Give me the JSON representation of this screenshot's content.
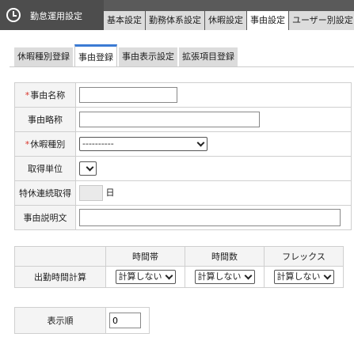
{
  "app": {
    "title": "勤怠運用設定",
    "icon": "clock-icon"
  },
  "top_tabs": [
    "基本設定",
    "勤務体系設定",
    "休暇設定",
    "事由設定",
    "ユーザー別設定"
  ],
  "sub_tabs": [
    "休暇種別登録",
    "事由登録",
    "事由表示設定",
    "拡張項目登録"
  ],
  "form": {
    "required_mark": "*",
    "reason_name_label": "事由名称",
    "reason_name_value": "",
    "reason_abbr_label": "事由略称",
    "reason_abbr_value": "",
    "leave_type_label": "休暇種別",
    "leave_type_selected": "----------",
    "unit_label": "取得単位",
    "unit_selected": "",
    "special_leave_label": "特休連続取得",
    "special_leave_value": "",
    "special_leave_unit": "日",
    "description_label": "事由説明文",
    "description_value": ""
  },
  "calc": {
    "headers": [
      "時間帯",
      "時間数",
      "フレックス"
    ],
    "row_label": "出勤時間計算",
    "values": [
      "計算しない",
      "計算しない",
      "計算しない"
    ]
  },
  "order": {
    "label": "表示順",
    "value": "0"
  },
  "colors": {
    "titlebar": "#5a5a5a",
    "active_tab_accent": "#3b7bd4",
    "required": "#d9342b"
  }
}
